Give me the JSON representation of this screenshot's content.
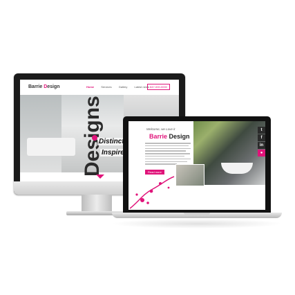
{
  "desktop": {
    "logo": {
      "brand": "Barrie",
      "brand_mark": "D",
      "rest": "esign"
    },
    "nav": {
      "items": [
        "Home",
        "Services",
        "Gallery",
        "Latest news"
      ],
      "phone": "647-000-0000"
    },
    "hero": {
      "vertical_word": "Designs",
      "line1": "Distinction,",
      "line2_prefix": "Inspired by",
      "line2_highlight": "m"
    }
  },
  "laptop": {
    "welcome": "Welcome, we Love it",
    "title_brand": "Barrie",
    "title_rest": " Design",
    "button": "Read more",
    "social": [
      "t",
      "f",
      "in",
      "●"
    ]
  },
  "colors": {
    "accent": "#e0147a",
    "dark": "#1b1b1b"
  }
}
